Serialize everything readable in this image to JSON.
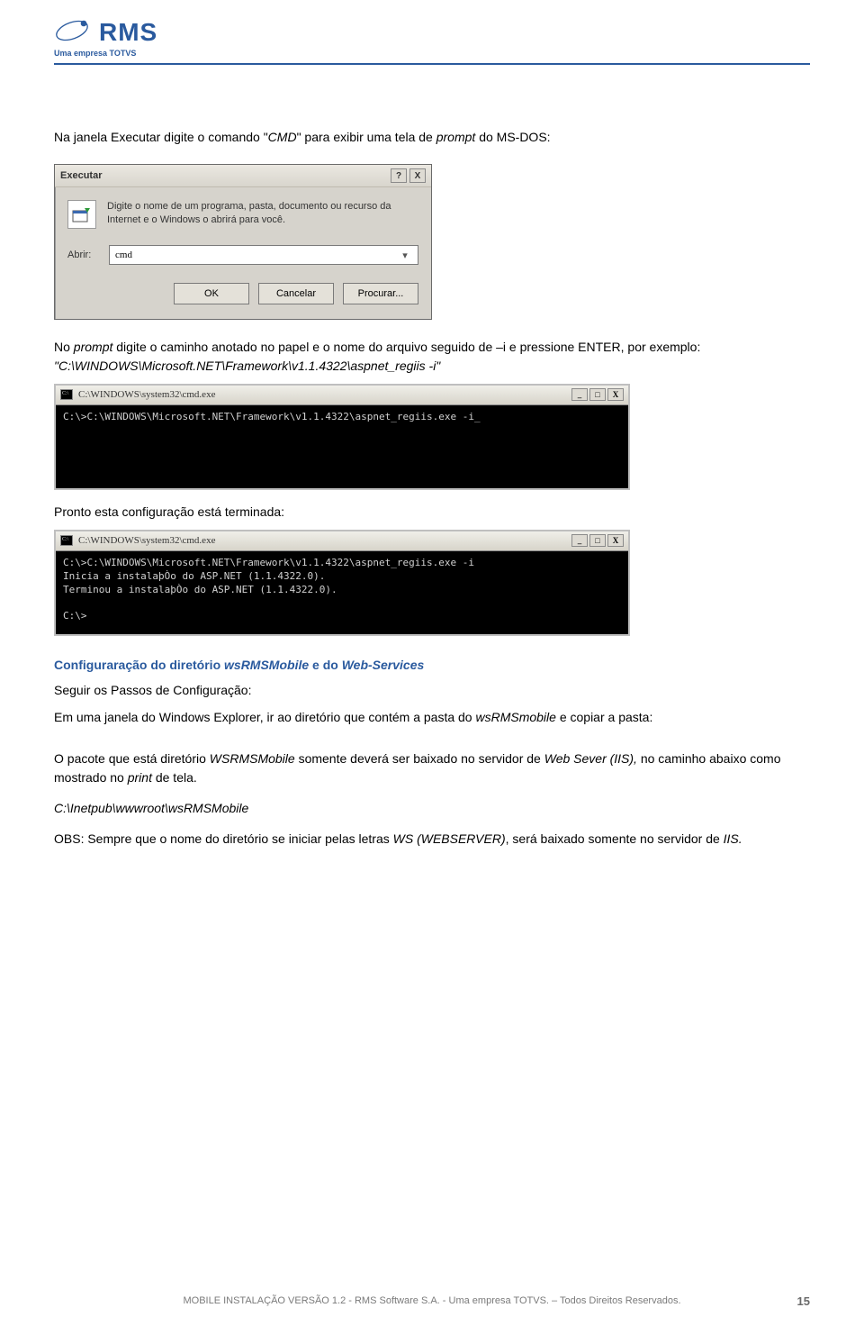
{
  "header": {
    "logo_text": "RMS",
    "tagline": "Uma empresa TOTVS"
  },
  "para1_prefix": "Na janela Executar digite o comando \"",
  "para1_cmd": "CMD",
  "para1_mid": "\" para exibir uma tela de ",
  "para1_prompt": "prompt",
  "para1_suffix": " do MS-DOS:",
  "run_dialog": {
    "title": "Executar",
    "help": "?",
    "close": "X",
    "description": "Digite o nome de um programa, pasta, documento ou recurso da Internet e o Windows o abrirá para você.",
    "open_label": "Abrir:",
    "open_value": "cmd",
    "ok": "OK",
    "cancel": "Cancelar",
    "browse": "Procurar..."
  },
  "para2_a": "No ",
  "para2_prompt": "prompt",
  "para2_b": " digite o caminho anotado no papel e o nome do arquivo seguido de –i e pressione ENTER, por exemplo: ",
  "para2_cmd_italic": "\"C:\\WINDOWS\\Microsoft.NET\\Framework\\v1.1.4322\\aspnet_regiis -i\"",
  "console1": {
    "title": "C:\\WINDOWS\\system32\\cmd.exe",
    "min": "_",
    "max": "□",
    "close": "X",
    "line1": "C:\\>C:\\WINDOWS\\Microsoft.NET\\Framework\\v1.1.4322\\aspnet_regiis.exe -i_"
  },
  "para3": "Pronto esta configuração está terminada:",
  "console2": {
    "title": "C:\\WINDOWS\\system32\\cmd.exe",
    "min": "_",
    "max": "□",
    "close": "X",
    "line1": "C:\\>C:\\WINDOWS\\Microsoft.NET\\Framework\\v1.1.4322\\aspnet_regiis.exe -i",
    "line2": "Inicia a instalaþÒo do ASP.NET (1.1.4322.0).",
    "line3": "Terminou a instalaþÒo do ASP.NET (1.1.4322.0).",
    "line4": "",
    "line5": "C:\\>"
  },
  "section_title_a": "Configuraração do diretório ",
  "section_title_b": "wsRMSMobile",
  "section_title_c": " e do ",
  "section_title_d": "Web-Services",
  "para4": "Seguir os Passos de Configuração:",
  "para5_a": "Em uma janela do Windows Explorer, ir ao diretório que contém a pasta do ",
  "para5_b": "wsRMSmobile",
  "para5_c": " e copiar a pasta:",
  "para6_a": "O pacote que está diretório ",
  "para6_b": "WSRMSMobile",
  "para6_c": " somente deverá ser baixado no servidor de ",
  "para6_d": "Web Sever (IIS),",
  "para6_e": " no caminho abaixo como mostrado no ",
  "para6_f": "print",
  "para6_g": " de tela.",
  "path_italic": "C:\\Inetpub\\wwwroot\\wsRMSMobile",
  "para7_a": "OBS: Sempre que o nome do diretório se iniciar pelas letras ",
  "para7_b": "WS (WEBSERVER)",
  "para7_c": ", será baixado somente no servidor de ",
  "para7_d": "IIS.",
  "footer": {
    "text": "MOBILE INSTALAÇÃO VERSÃO 1.2 - RMS Software S.A. - Uma empresa TOTVS. – Todos Direitos Reservados.",
    "page": "15"
  },
  "watermark": ""
}
